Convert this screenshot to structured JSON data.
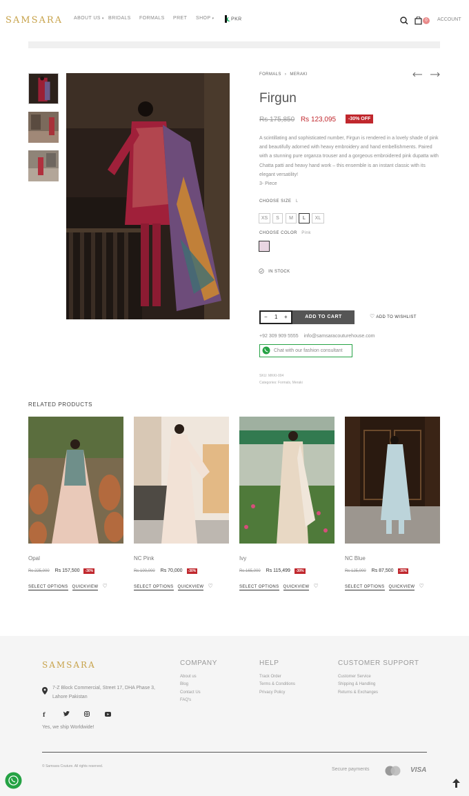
{
  "header": {
    "logo": "SAMSARA",
    "nav": [
      "ABOUT US",
      "BRIDALS",
      "FORMALS",
      "PRET",
      "SHOP",
      "PKR"
    ],
    "cart_count": "0",
    "account": "ACCOUNT"
  },
  "breadcrumb": {
    "cat1": "FORMALS",
    "sep": "›",
    "cat2": "MERAKI"
  },
  "product": {
    "title": "Firgun",
    "old_price": "Rs 175,850",
    "new_price": "Rs 123,095",
    "discount": "-30% OFF",
    "description": "A scintillating and sophisticated number, Firgun is rendered in a lovely shade of pink and beautifully adorned with heavy embroidery and hand embellishments. Paired with a stunning pure organza trouser and a gorgeous embroidered pink dupatta with Chatta patti and heavy hand work – this ensemble is an instant classic with its elegant versatility!",
    "pieces": "3- Piece",
    "size_label": "CHOOSE SIZE",
    "size_selected": "L",
    "sizes": [
      "XS",
      "S",
      "M",
      "L",
      "XL"
    ],
    "color_label": "CHOOSE COLOR",
    "color_selected": "Pink",
    "color_swatch": "#e9d6e2",
    "stock": "IN STOCK",
    "qty_minus": "−",
    "qty": "1",
    "qty_plus": "+",
    "add_to_cart": "ADD TO CART",
    "wishlist": "ADD TO WISHLIST",
    "phone": "+92 309 909 5555",
    "email": "info@samsaracouturehouse.com",
    "chat": "Chat with our fashion consultant",
    "sku": "SKU: MKKI-004",
    "categories": "Categories: Formals, Meraki"
  },
  "related": {
    "heading": "RELATED PRODUCTS",
    "select_label": "SELECT OPTIONS",
    "quickview_label": "QUICKVIEW",
    "items": [
      {
        "name": "Opal",
        "old": "Rs 225,000",
        "new": "Rs 157,500",
        "badge": "-30%"
      },
      {
        "name": "NC Pink",
        "old": "Rs 100,000",
        "new": "Rs 70,000",
        "badge": "-30%"
      },
      {
        "name": "Ivy",
        "old": "Rs 165,000",
        "new": "Rs 115,499",
        "badge": "-30%"
      },
      {
        "name": "NC Blue",
        "old": "Rs 125,000",
        "new": "Rs 87,500",
        "badge": "-30%"
      }
    ]
  },
  "footer": {
    "logo": "SAMSARA",
    "address": "7-Z Block Commercial, Street 17, DHA Phase 3, Lahore Pakistan",
    "ship": "Yes, we ship Worldwide!",
    "company": {
      "title": "COMPANY",
      "links": [
        "About us",
        "Blog",
        "Contact Us",
        "FAQ's"
      ]
    },
    "help": {
      "title": "HELP",
      "links": [
        "Track Order",
        "Terms & Conditions",
        "Privacy Policy"
      ]
    },
    "support": {
      "title": "CUSTOMER SUPPORT",
      "links": [
        "Customer Service",
        "Shipping & Handling",
        "Returns & Exchanges"
      ]
    },
    "copyright": "© Samsara Couture. All rights reserved.",
    "secure": "Secure payments",
    "visa": "VISA",
    "social": [
      "f",
      "t",
      "ig",
      "yt"
    ]
  },
  "colors": {
    "accent": "#c0272d",
    "gold": "#c7a24a",
    "whatsapp": "#25a244"
  }
}
